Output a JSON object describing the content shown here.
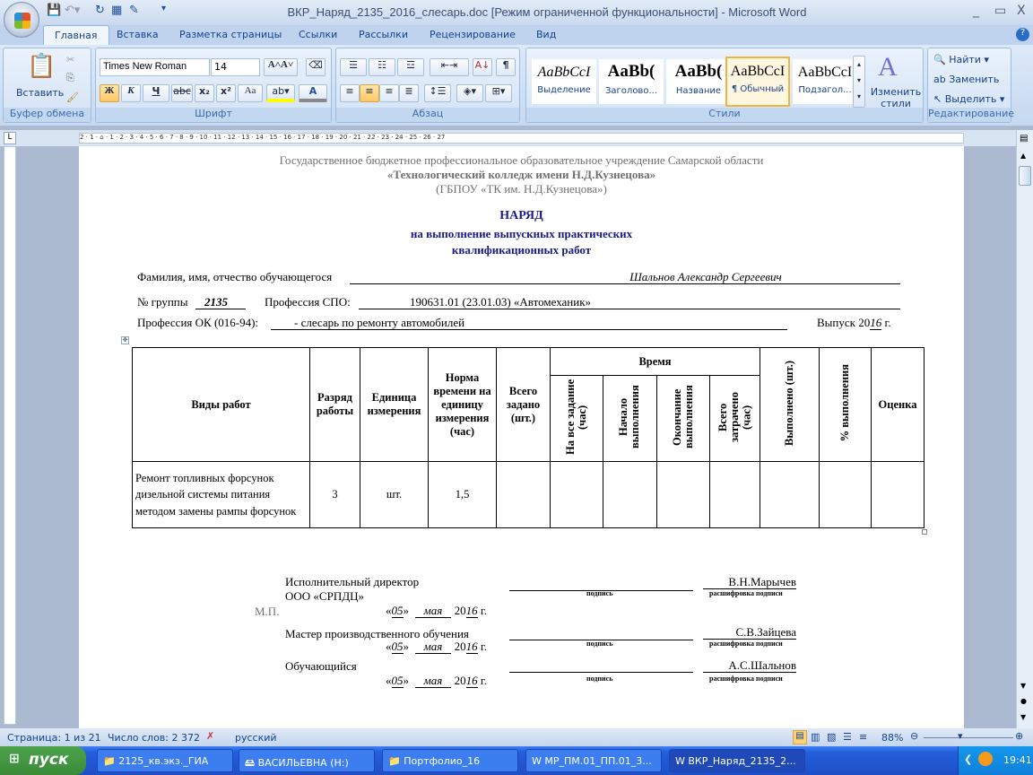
{
  "window": {
    "title": "ВКР_Наряд_2135_2016_слесарь.doc [Режим ограниченной функциональности] - Microsoft Word",
    "minimize": "_",
    "restore": "▭",
    "close": "X"
  },
  "tabs": [
    "Главная",
    "Вставка",
    "Разметка страницы",
    "Ссылки",
    "Рассылки",
    "Рецензирование",
    "Вид"
  ],
  "ribbon": {
    "clipboard": {
      "label": "Буфер обмена",
      "paste": "Вставить"
    },
    "font": {
      "label": "Шрифт",
      "name": "Times New Roman",
      "size": "14",
      "bold": "Ж",
      "italic": "К",
      "underline": "Ч",
      "strike": "abc",
      "sub": "x₂",
      "sup": "x²",
      "case": "Aa",
      "grow": "A˄",
      "shrink": "A˅",
      "color": "A"
    },
    "paragraph": {
      "label": "Абзац",
      "show_marks": "¶"
    },
    "styles": {
      "label": "Стили",
      "items": [
        {
          "sample": "AaBbCcI",
          "name": "Выделение"
        },
        {
          "sample": "AaBb(",
          "name": "Заголово..."
        },
        {
          "sample": "AaBb(",
          "name": "Название"
        },
        {
          "sample": "AaBbCcI",
          "name": "¶ Обычный"
        },
        {
          "sample": "AaBbCcI",
          "name": "Подзагол..."
        }
      ],
      "change": "Изменить стили"
    },
    "editing": {
      "label": "Редактирование",
      "find": "Найти",
      "replace": "Заменить",
      "select": "Выделить"
    }
  },
  "ruler": "2 · 1 · ⌂ · 1 · 2 · 3 · 4 · 5 · 6 · 7 · 8 · 9 · 10 · 11 · 12 · 13 · 14 · 15 · 16 · 17 · 18 · 19 · 20 · 21 · 22 · 23 · 24 · 25 · 26 · 27",
  "doc": {
    "org1": "Государственное бюджетное профессиональное образовательное учреждение Самарской области",
    "org2": "«Технологический колледж имени Н.Д.Кузнецова»",
    "org3": "(ГБПОУ «ТК им. Н.Д.Кузнецова»)",
    "title": "НАРЯД",
    "subtitle1": "на выполнение  выпускных практических",
    "subtitle2": "квалификационных  работ",
    "fio_label": "Фамилия, имя, отчество обучающегося",
    "fio_value": "Шальнов Александр Сергеевич",
    "group_label": "№ группы",
    "group_value": "2135",
    "spo_label": "Профессия СПО:",
    "spo_value": "190631.01  (23.01.03) «Автомеханик»",
    "ok_label": "Профессия ОК (016-94):",
    "ok_value": "- слесарь по ремонту автомобилей",
    "year_label": "Выпуск 20",
    "year_value": "16",
    "year_suffix": " г.",
    "table": {
      "headers": {
        "type": "Виды работ",
        "rank": "Разряд работы",
        "unit": "Единица измерения",
        "norm": "Норма времени на единицу измерения (час)",
        "total": "Всего задано (шт.)",
        "time": "Время",
        "t1": "На все задание (час)",
        "t2": "Начало выполнения",
        "t3": "Окончание выполнения",
        "t4": "Всего затрачено (час)",
        "done": "Выполнено (шт.)",
        "pct": "% выполнения",
        "grade": "Оценка"
      },
      "row": {
        "type": "Ремонт топливных форсунок дизельной системы питания методом замены рампы форсунок",
        "rank": "3",
        "unit": "шт.",
        "norm": "1,5"
      }
    },
    "signs": [
      {
        "role": "Исполнительный директор",
        "role2": "ООО «СРПДЦ»",
        "name": "В.Н.Марычев"
      },
      {
        "role": "Мастер производственного обучения",
        "name": "С.В.Зайцева"
      },
      {
        "role": "Обучающийся",
        "name": "А.С.Шальнов"
      }
    ],
    "sign_caption": "подпись",
    "decode_caption": "расшифровка подписи",
    "mp": "М.П.",
    "date": {
      "open": "«",
      "day": "05",
      "close": "»",
      "month": "мая",
      "y1": "20",
      "y2": "16",
      "suffix": " г."
    }
  },
  "status": {
    "page": "Страница: 1 из 21",
    "words": "Число слов: 2 372",
    "lang": "русский",
    "zoom": "88%"
  },
  "taskbar": {
    "start": "пуск",
    "items": [
      "2125_кв.экз._ГИА",
      "ВАСИЛЬЕВНА (H:)",
      "Портфолио_16",
      "МР_ПМ.01_ПП.01_3...",
      "ВКР_Наряд_2135_2..."
    ],
    "clock": "19:41"
  }
}
